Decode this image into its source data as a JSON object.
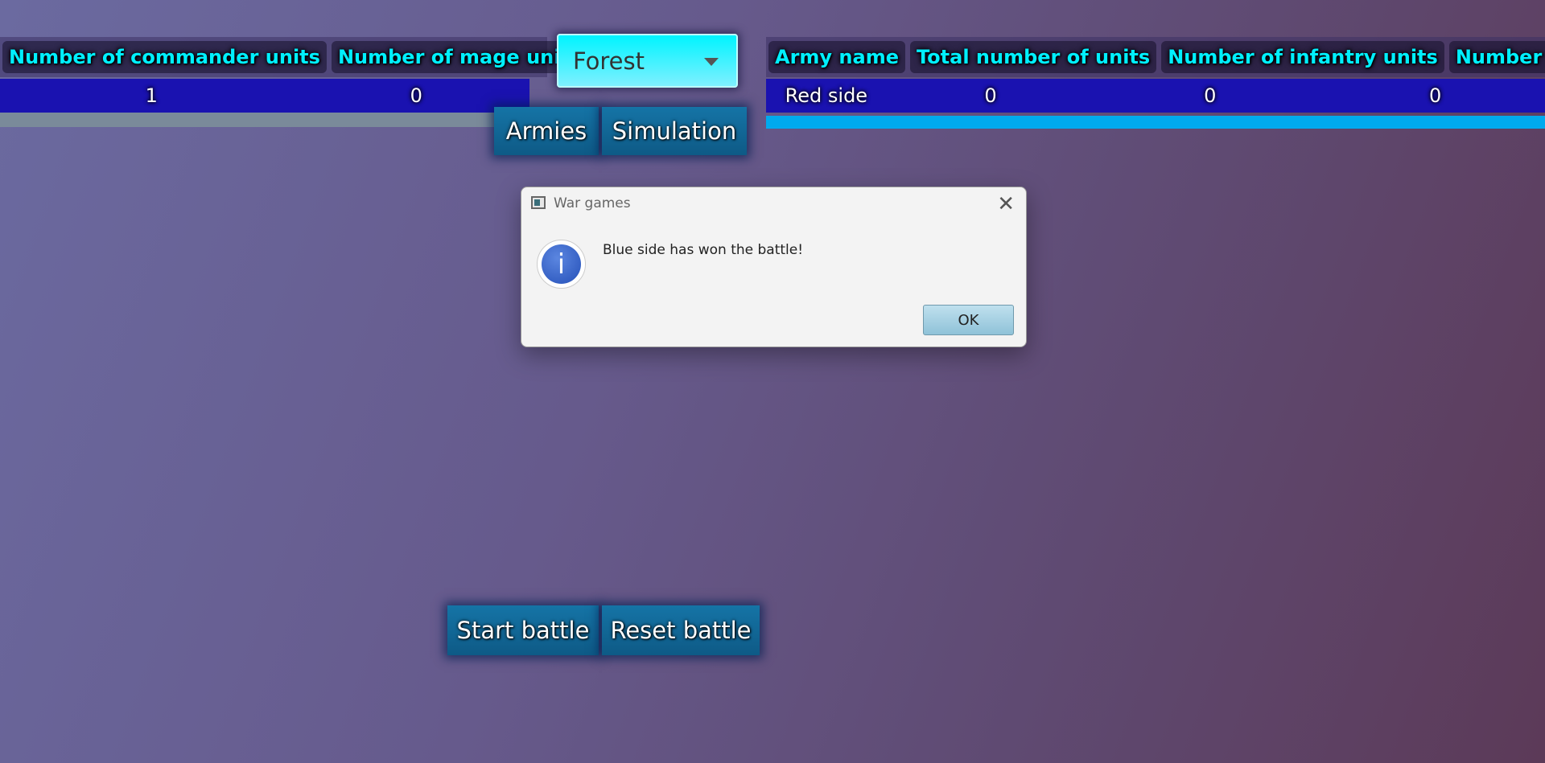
{
  "left_table": {
    "headers": [
      "Number of commander units",
      "Number of mage units"
    ],
    "row": [
      "1",
      "0"
    ]
  },
  "terrain_select": {
    "value": "Forest",
    "icon": "chevron-down-icon"
  },
  "nav": {
    "armies": "Armies",
    "simulation": "Simulation"
  },
  "right_table": {
    "headers": [
      "Army name",
      "Total number of units",
      "Number of infantry units",
      "Number of rang"
    ],
    "row": [
      "Red side",
      "0",
      "0",
      "0"
    ]
  },
  "actions": {
    "start": "Start battle",
    "reset": "Reset battle"
  },
  "dialog": {
    "title": "War games",
    "message": "Blue side has won the battle!",
    "ok": "OK",
    "info_glyph": "i",
    "close_glyph": "✕"
  },
  "colors": {
    "header_text": "#00f0ff",
    "row_bg": "#1a12b0",
    "button_bg": "#1574a6",
    "accent_bar": "#00aaee"
  }
}
